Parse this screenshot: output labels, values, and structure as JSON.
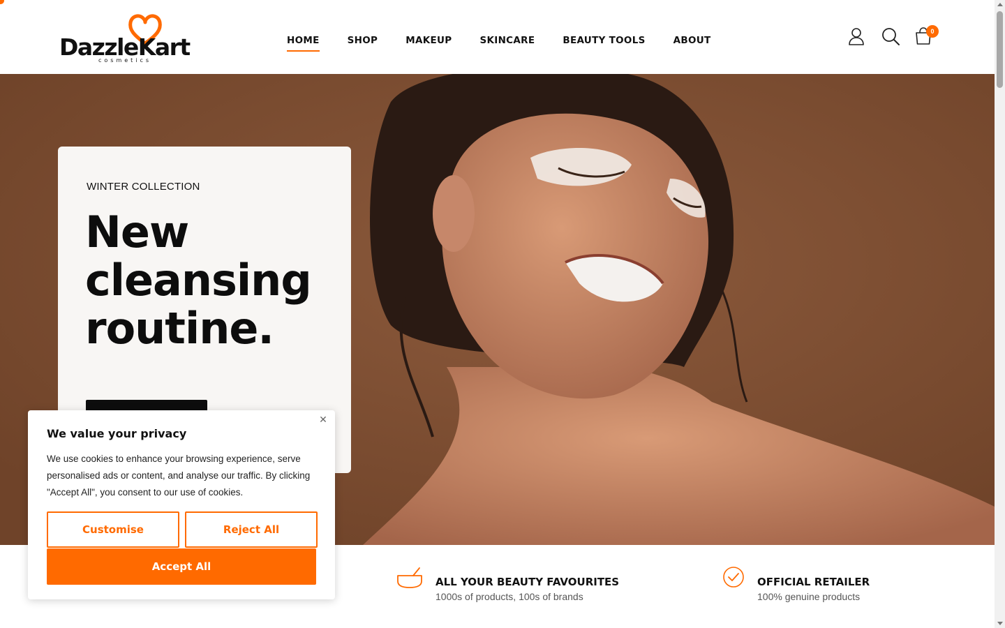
{
  "brand": {
    "name": "DazzleKart",
    "tagline": "cosmetics",
    "accent": "#ff6a00"
  },
  "nav": {
    "items": [
      {
        "label": "HOME",
        "active": true
      },
      {
        "label": "SHOP"
      },
      {
        "label": "MAKEUP"
      },
      {
        "label": "SKINCARE"
      },
      {
        "label": "BEAUTY TOOLS"
      },
      {
        "label": "ABOUT"
      }
    ]
  },
  "header_icons": {
    "account": "user-icon",
    "search": "search-icon",
    "cart": "cart-icon",
    "cart_count": "0"
  },
  "hero": {
    "kicker": "WINTER COLLECTION",
    "title_line1": "New",
    "title_line2": "cleansing",
    "title_line3": "routine.",
    "background": "#7e5034"
  },
  "features": [
    {
      "icon": "mortar-bowl-icon",
      "title": "ALL YOUR BEAUTY FAVOURITES",
      "subtitle": "1000s of products, 100s of brands"
    },
    {
      "icon": "check-circle-icon",
      "title": "OFFICIAL RETAILER",
      "subtitle": "100% genuine products"
    }
  ],
  "cookie": {
    "title": "We value your privacy",
    "text": "We use cookies to enhance your browsing experience, serve personalised ads or content, and analyse our traffic. By clicking \"Accept All\", you consent to our use of cookies.",
    "customise_label": "Customise",
    "reject_label": "Reject All",
    "accept_label": "Accept All",
    "close_symbol": "✕"
  }
}
